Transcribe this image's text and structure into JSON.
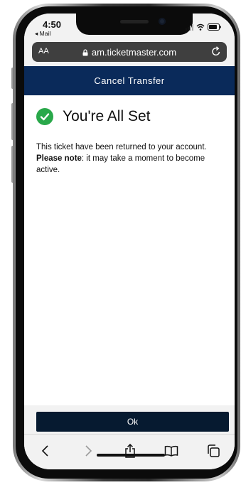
{
  "status_bar": {
    "time": "4:50",
    "back_app": "◂ Mail",
    "icons": [
      "signal-icon",
      "wifi-icon",
      "battery-icon"
    ]
  },
  "browser": {
    "text_size_label": "AA",
    "url": "am.ticketmaster.com",
    "toolbar": [
      "back-icon",
      "forward-icon",
      "share-icon",
      "bookmarks-icon",
      "tabs-icon"
    ]
  },
  "header": {
    "title": "Cancel Transfer"
  },
  "main": {
    "heading": "You're All Set",
    "message": "This ticket have been returned to your account.",
    "note_label": "Please note",
    "note_text": ": it may take a moment to become active."
  },
  "actions": {
    "ok_label": "Ok"
  },
  "colors": {
    "header_bg": "#0a2a5a",
    "button_bg": "#061a30",
    "success": "#29a84a"
  }
}
